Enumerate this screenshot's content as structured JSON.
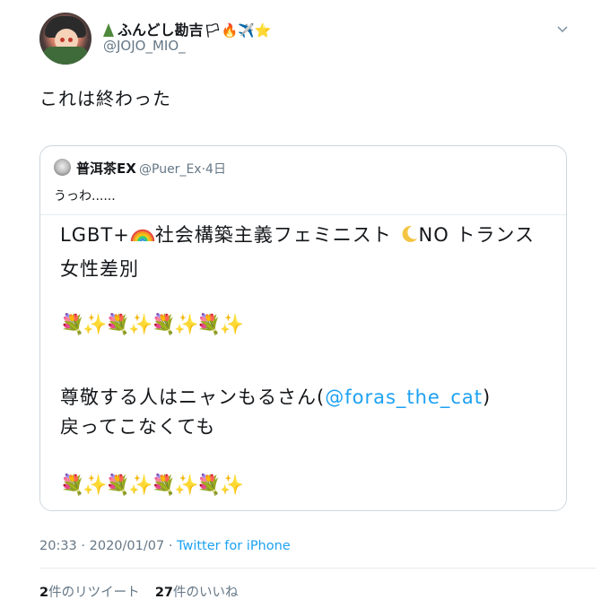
{
  "author": {
    "display_name": "ふんどし勘吉",
    "name_emojis": "🏳🔥✈️⭐",
    "handle": "@JOJO_MIO_"
  },
  "tweet": {
    "text": "これは終わった"
  },
  "quoted_tweet": {
    "name": "普洱茶EX",
    "handle": "@Puer_Ex",
    "separator": "·",
    "age": "4日",
    "text": "うっわ......",
    "media": {
      "line1_prefix": "LGBT+",
      "line1_middle": "社会構築主義フェミニスト",
      "line1_suffix": "NO トランス",
      "line2": "女性差別",
      "emoji_row_1": "💐✨💐✨💐✨💐✨",
      "line3_prefix": "尊敬する人はニャンもるさん(",
      "line3_mention": "@foras_the_cat",
      "line3_suffix": ")",
      "line4": "戻ってこなくても",
      "emoji_row_2": "💐✨💐✨💐✨💐✨"
    }
  },
  "meta": {
    "time": "20:33",
    "date": "2020/01/07",
    "separator": "·",
    "source": "Twitter for iPhone"
  },
  "stats": {
    "retweets_count": "2",
    "retweets_label": "件のリツイート",
    "likes_count": "27",
    "likes_label": "件のいいね"
  },
  "colors": {
    "link": "#1da1f2",
    "secondary_text": "#657786",
    "border": "#ccd6dd"
  }
}
